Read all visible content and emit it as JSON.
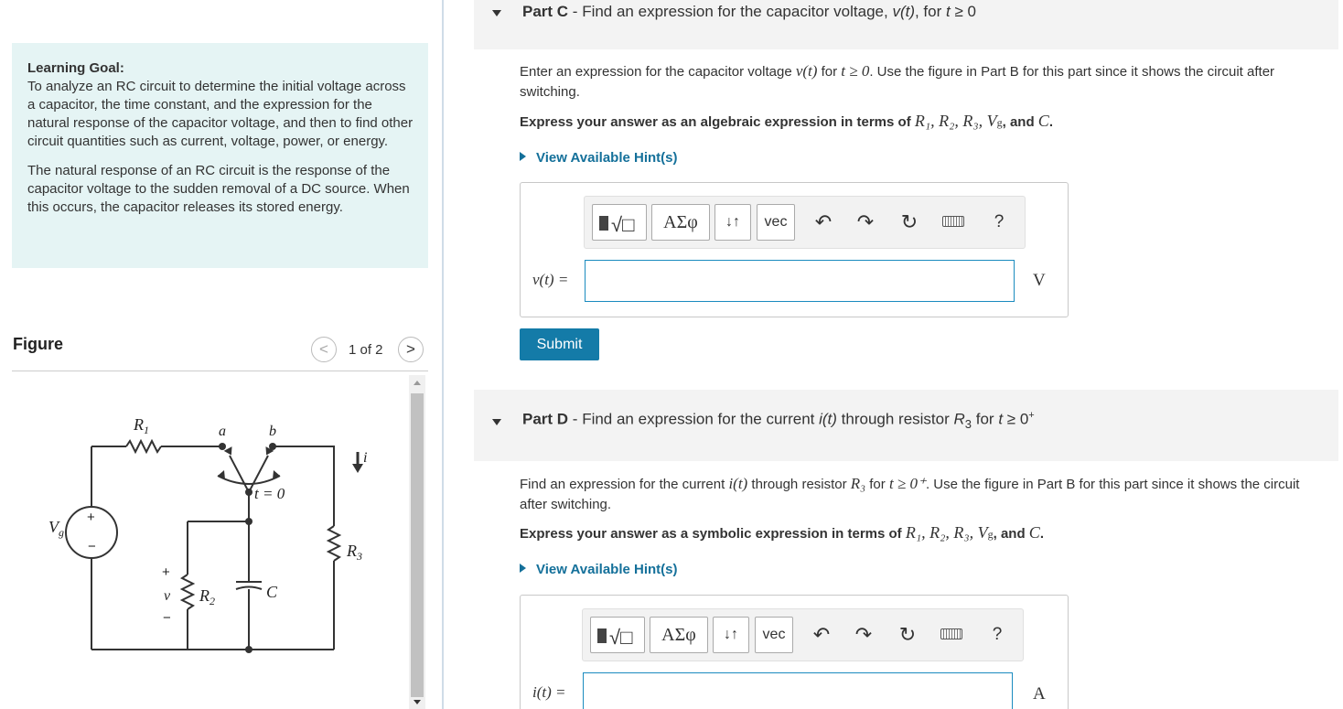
{
  "learning_goal": {
    "title": "Learning Goal:",
    "text": "To analyze an RC circuit to determine the initial voltage across a capacitor, the time constant, and the expression for the natural response of the capacitor voltage, and then to find other circuit quantities such as current, voltage, power, or energy.",
    "paragraph2": "The natural response of an RC circuit is the response of the capacitor voltage to the sudden removal of a DC source. When this occurs, the capacitor releases its stored energy."
  },
  "figure": {
    "title": "Figure",
    "pager": "1 of 2",
    "prev_label": "<",
    "next_label": ">",
    "labels": {
      "r1": "R",
      "r1_sub": "1",
      "r2": "R",
      "r2_sub": "2",
      "r3": "R",
      "r3_sub": "3",
      "vg": "V",
      "vg_sub": "g",
      "c": "C",
      "a": "a",
      "b": "b",
      "t0": "t = 0",
      "i": "i",
      "v": "v",
      "plus": "+",
      "minus": "−"
    }
  },
  "partC": {
    "label": "Part C",
    "title": "Find an expression for the capacitor voltage, ",
    "title_var": "v(t)",
    "title_end": ", for ",
    "title_cond": "t",
    "title_cond2": " ≥ 0",
    "instr_a": "Enter an expression for the capacitor voltage ",
    "instr_var": "v(t)",
    "instr_b": " for ",
    "instr_cond": "t ≥ 0",
    "instr_c": ". Use the figure in Part B for this part since it shows the circuit after switching.",
    "express_a": "Express your answer as an algebraic expression in terms of ",
    "express_vars": "R₁, R₂, R₃, V",
    "express_vars_sub": "g",
    "express_b": ", and ",
    "express_c": "C",
    "express_end": ".",
    "hint": "View Available Hint(s)",
    "answer_label": "v(t) =",
    "unit": "V",
    "submit": "Submit"
  },
  "partD": {
    "label": "Part D",
    "title": "Find an expression for the current ",
    "title_var": "i(t)",
    "title_mid": " through resistor ",
    "title_r": "R",
    "title_r_sub": "3",
    "title_end": " for ",
    "title_cond": "t",
    "title_cond2": " ≥ 0",
    "title_sup": "+",
    "instr_a": "Find an expression for the current ",
    "instr_var": "i(t)",
    "instr_b": " through resistor ",
    "instr_r": "R₃",
    "instr_c": " for ",
    "instr_cond": "t ≥ 0⁺",
    "instr_d": ". Use the figure in Part B for this part since it shows the circuit after switching.",
    "express_a": "Express your answer as a symbolic expression in terms of ",
    "express_vars": "R₁, R₂, R₃, V",
    "express_vars_sub": "g",
    "express_b": ", and ",
    "express_c": "C",
    "express_end": ".",
    "hint": "View Available Hint(s)",
    "answer_label": "i(t) =",
    "unit": "A"
  },
  "toolbar": {
    "greek": "ΑΣφ",
    "sort": "↓↑",
    "vec": "vec",
    "help": "?"
  }
}
